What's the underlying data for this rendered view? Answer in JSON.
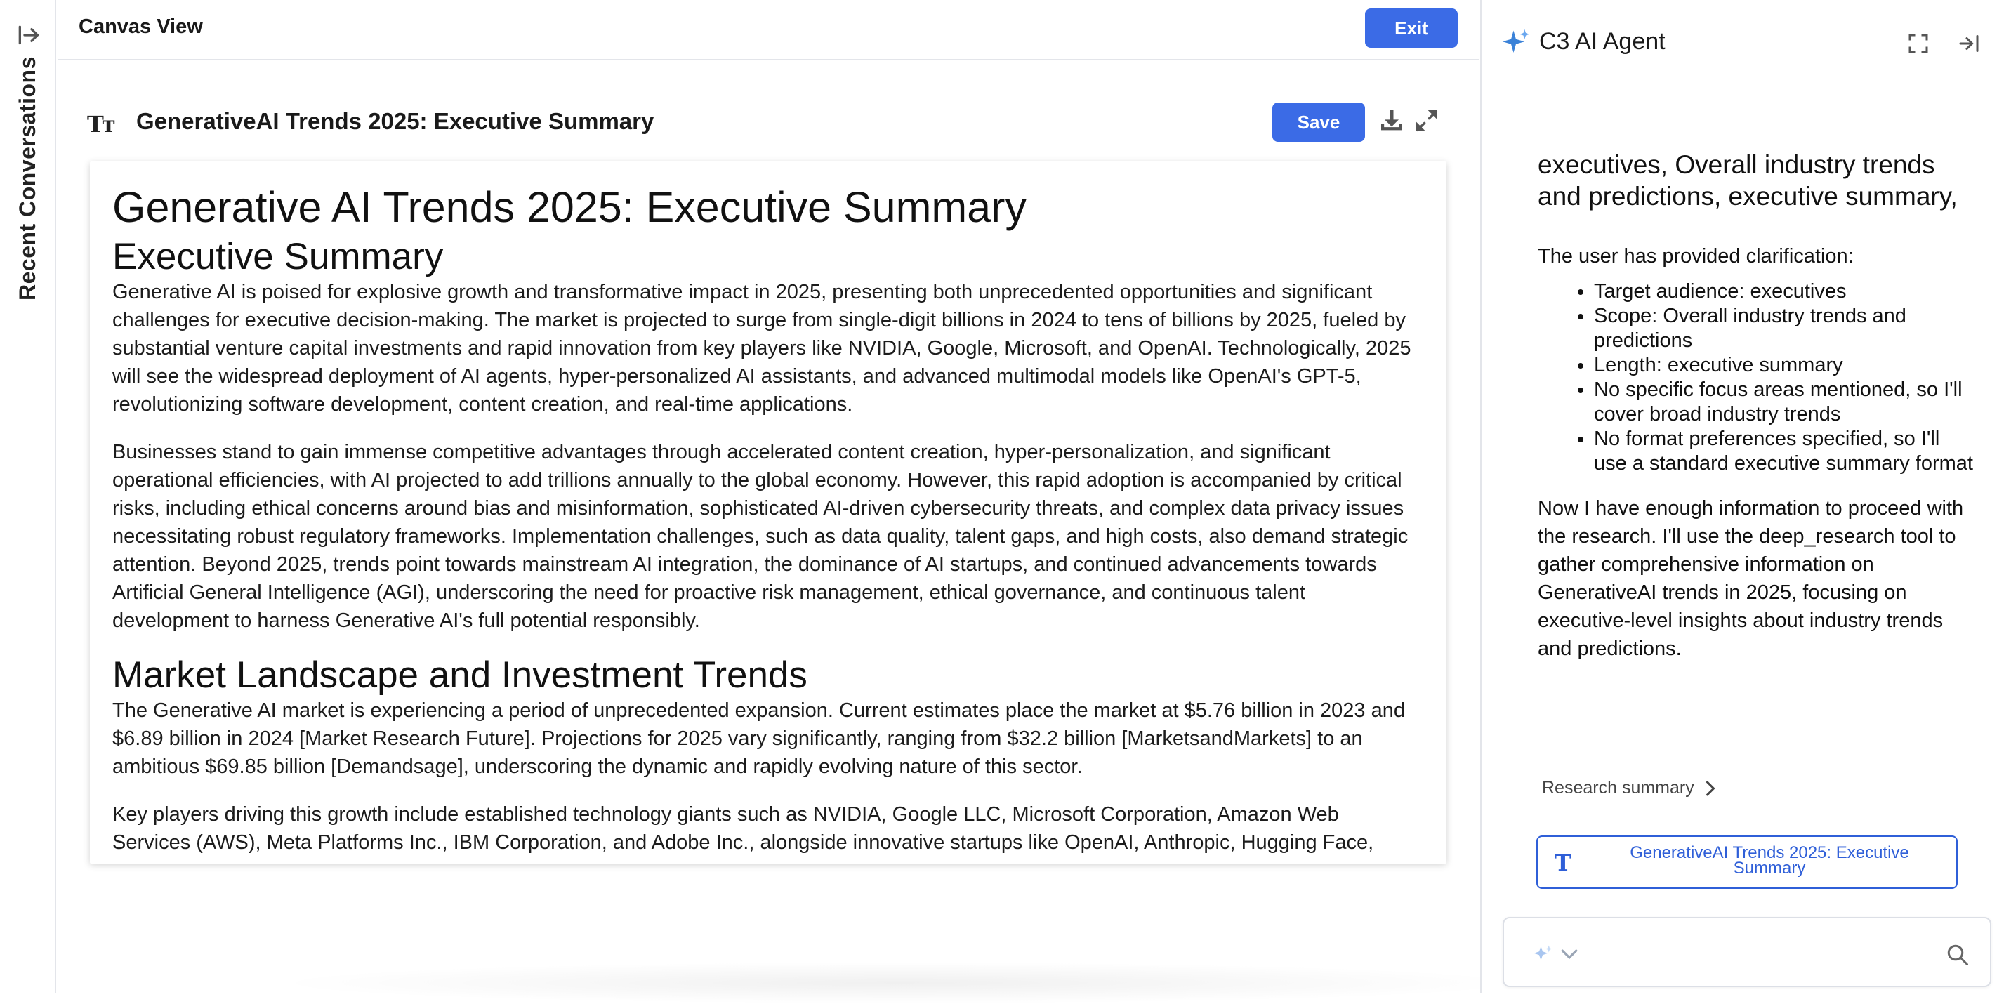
{
  "rail": {
    "label": "Recent Conversations"
  },
  "canvas": {
    "title": "Canvas View",
    "exit_label": "Exit",
    "doc_title": "GenerativeAI Trends 2025: Executive Summary",
    "save_label": "Save",
    "tt_icon_text": "Tт"
  },
  "document": {
    "h1": "Generative AI Trends 2025: Executive Summary",
    "h2_exec": "Executive Summary",
    "p1": "Generative AI is poised for explosive growth and transformative impact in 2025, presenting both unprecedented opportunities and significant challenges for executive decision-making. The market is projected to surge from single-digit billions in 2024 to tens of billions by 2025, fueled by substantial venture capital investments and rapid innovation from key players like NVIDIA, Google, Microsoft, and OpenAI. Technologically, 2025 will see the widespread deployment of AI agents, hyper-personalized AI assistants, and advanced multimodal models like OpenAI's GPT-5, revolutionizing software development, content creation, and real-time applications.",
    "p2": "Businesses stand to gain immense competitive advantages through accelerated content creation, hyper-personalization, and significant operational efficiencies, with AI projected to add trillions annually to the global economy. However, this rapid adoption is accompanied by critical risks, including ethical concerns around bias and misinformation, sophisticated AI-driven cybersecurity threats, and complex data privacy issues necessitating robust regulatory frameworks. Implementation challenges, such as data quality, talent gaps, and high costs, also demand strategic attention. Beyond 2025, trends point towards mainstream AI integration, the dominance of AI startups, and continued advancements towards Artificial General Intelligence (AGI), underscoring the need for proactive risk management, ethical governance, and continuous talent development to harness Generative AI's full potential responsibly.",
    "h2_market": "Market Landscape and Investment Trends",
    "p3": "The Generative AI market is experiencing a period of unprecedented expansion. Current estimates place the market at $5.76 billion in 2023 and $6.89 billion in 2024 [Market Research Future]. Projections for 2025 vary significantly, ranging from $32.2 billion [MarketsandMarkets] to an ambitious $69.85 billion [Demandsage], underscoring the dynamic and rapidly evolving nature of this sector.",
    "p4": "Key players driving this growth include established technology giants such as NVIDIA, Google LLC, Microsoft Corporation, Amazon Web Services (AWS), Meta Platforms Inc., IBM Corporation, and Adobe Inc., alongside innovative startups like OpenAI, Anthropic, Hugging Face,"
  },
  "agent": {
    "title": "C3 AI Agent",
    "heading": "executives, Overall industry trends and predictions, executive summary,",
    "clarification_intro": "The user has provided clarification:",
    "clarifications": [
      "Target audience: executives",
      "Scope: Overall industry trends and predictions",
      "Length: executive summary",
      "No specific focus areas mentioned, so I'll cover broad industry trends",
      "No format preferences specified, so I'll use a standard executive summary format"
    ],
    "next_step": "Now I have enough information to proceed with the research. I'll use the deep_research tool to gather comprehensive information on GenerativeAI trends in 2025, focusing on executive-level insights about industry trends and predictions.",
    "research_summary_label": "Research summary",
    "doc_chip_label": "GenerativeAI Trends 2025: Executive Summary",
    "chip_icon_text": "T",
    "input_value": ""
  },
  "colors": {
    "accent": "#3b6be6",
    "link": "#2f5fd8",
    "border": "#e3e5ea"
  }
}
